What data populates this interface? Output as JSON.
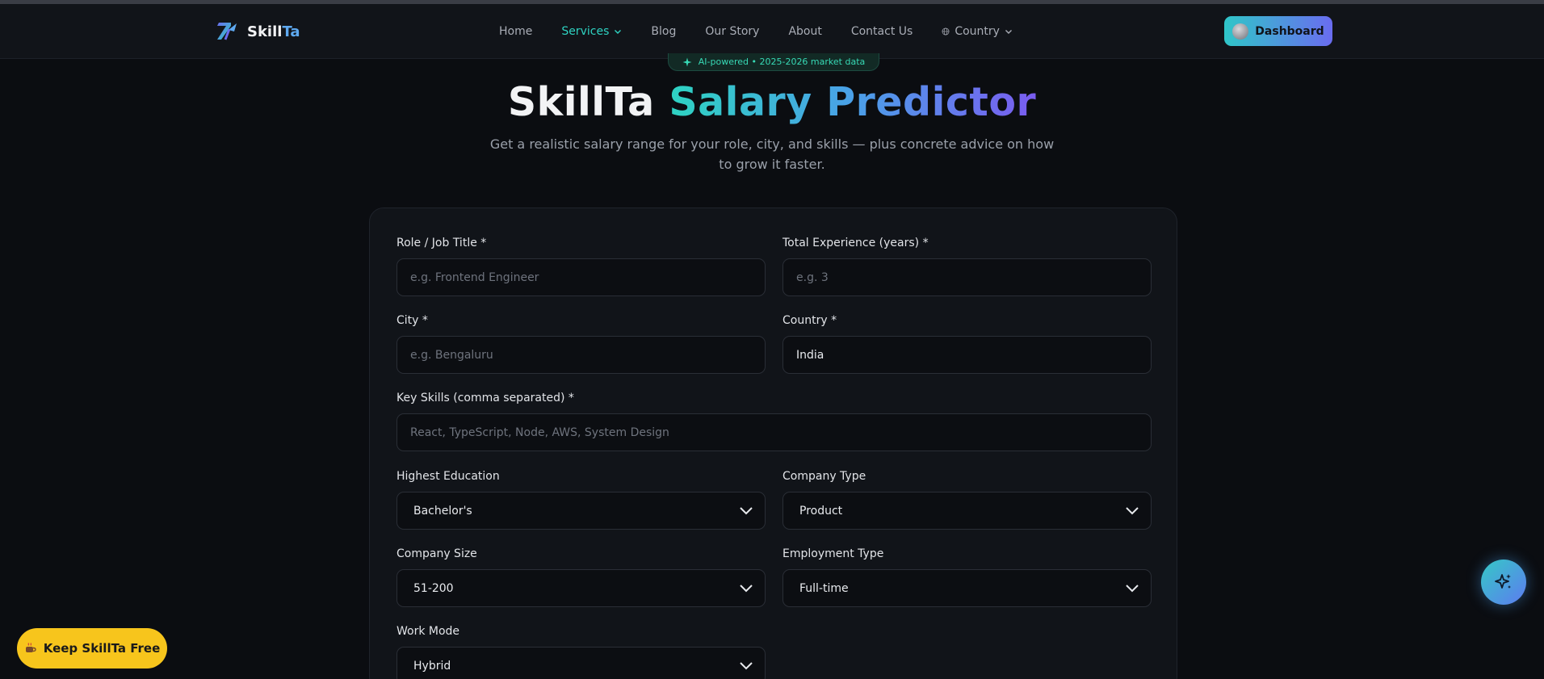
{
  "brand": {
    "name_part1": "Skill",
    "name_part2": "Ta"
  },
  "nav": {
    "items": [
      {
        "label": "Home",
        "active": false
      },
      {
        "label": "Services",
        "active": true,
        "has_dropdown": true
      },
      {
        "label": "Blog",
        "active": false
      },
      {
        "label": "Our Story",
        "active": false
      },
      {
        "label": "About",
        "active": false
      },
      {
        "label": "Contact Us",
        "active": false
      }
    ],
    "country_label": "Country",
    "dashboard_label": "Dashboard"
  },
  "hero": {
    "badge": "AI-powered • 2025-2026 market data",
    "title_plain": "SkillTa ",
    "title_gradient": "Salary Predictor",
    "subtitle": "Get a realistic salary range for your role, city, and skills — plus concrete advice on how to grow it faster."
  },
  "form": {
    "role": {
      "label": "Role / Job Title *",
      "placeholder": "e.g. Frontend Engineer",
      "value": ""
    },
    "experience": {
      "label": "Total Experience (years) *",
      "placeholder": "e.g. 3",
      "value": ""
    },
    "city": {
      "label": "City *",
      "placeholder": "e.g. Bengaluru",
      "value": ""
    },
    "country": {
      "label": "Country *",
      "placeholder": "",
      "value": "India"
    },
    "skills": {
      "label": "Key Skills (comma separated) *",
      "placeholder": "React, TypeScript, Node, AWS, System Design",
      "value": ""
    },
    "education": {
      "label": "Highest Education",
      "selected": "Bachelor's"
    },
    "company_type": {
      "label": "Company Type",
      "selected": "Product"
    },
    "company_size": {
      "label": "Company Size",
      "selected": "51-200"
    },
    "employment_type": {
      "label": "Employment Type",
      "selected": "Full-time"
    },
    "work_mode": {
      "label": "Work Mode",
      "selected": "Hybrid"
    }
  },
  "floating": {
    "keep_free_label": "Keep SkillTa Free"
  },
  "colors": {
    "accent_teal": "#2ed3c2",
    "accent_violet": "#7a5cf0",
    "keep_free_yellow": "#f7c51c",
    "background": "#0b0d11"
  },
  "icons": {
    "logo": "skillta-logo-icon",
    "globe": "globe-icon",
    "chevron": "chevron-down-icon",
    "sparkle": "sparkle-icon",
    "coffee": "coffee-icon"
  }
}
